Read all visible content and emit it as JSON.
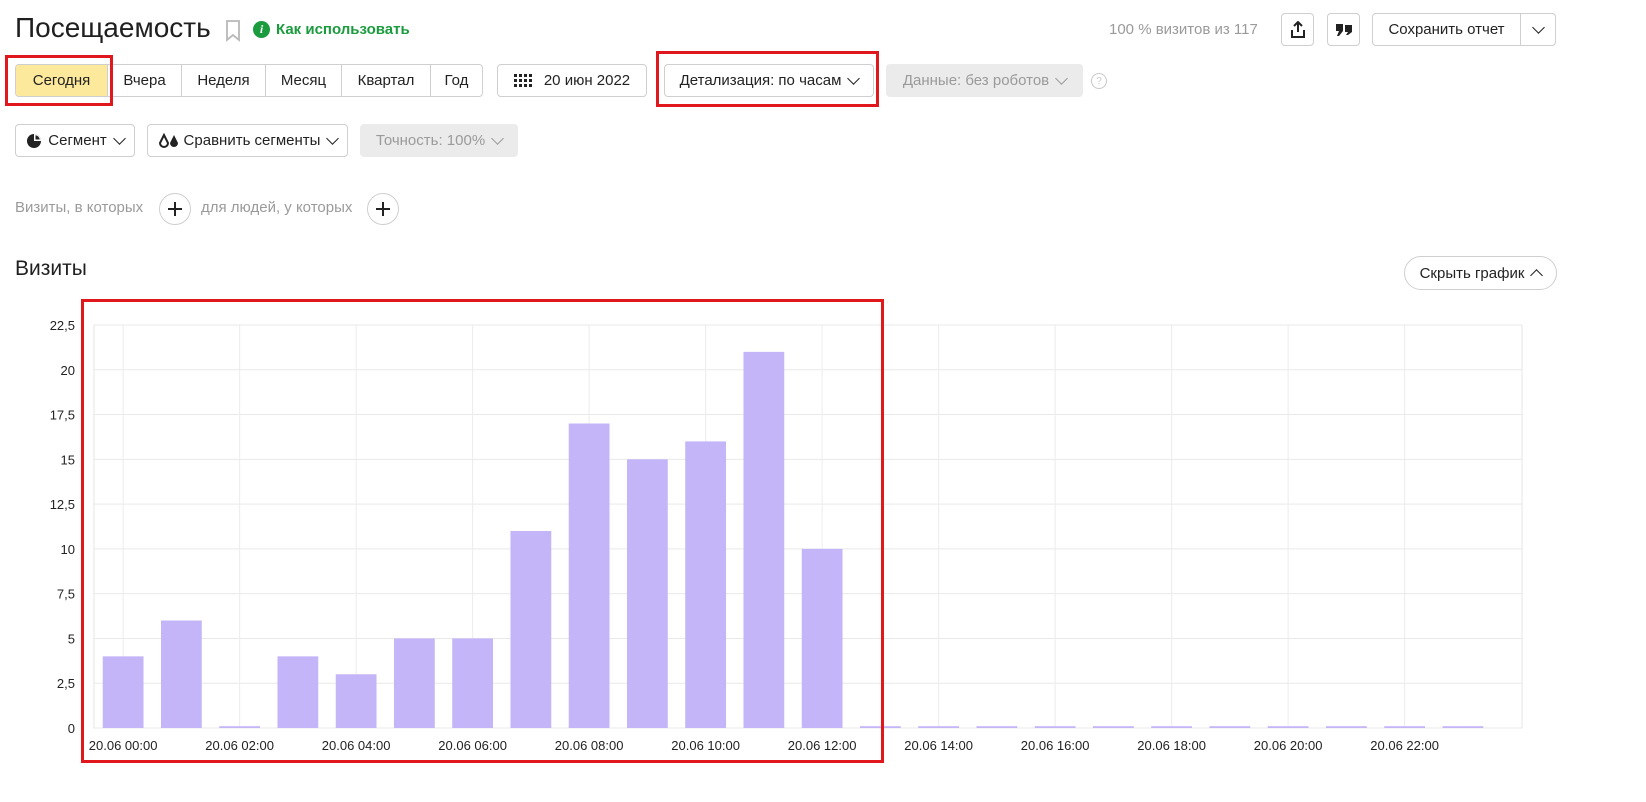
{
  "header": {
    "title": "Посещаемость",
    "how_to_use": "Как использовать",
    "visits_info": "100 % визитов из 117",
    "save_report": "Сохранить отчет"
  },
  "periods": [
    "Сегодня",
    "Вчера",
    "Неделя",
    "Месяц",
    "Квартал",
    "Год"
  ],
  "active_period": "Сегодня",
  "date_button": "20 июн 2022",
  "detail_button": "Детализация: по часам",
  "data_button": "Данные: без роботов",
  "segment_button": "Сегмент",
  "compare_button": "Сравнить сегменты",
  "accuracy_button": "Точность: 100%",
  "filters": {
    "visits_label": "Визиты, в которых",
    "people_label": "для людей, у которых"
  },
  "section": {
    "title": "Визиты",
    "hide_chart": "Скрыть график"
  },
  "colors": {
    "accent_green": "#1a9b3e",
    "active_period_bg": "#fde99b",
    "bar": "#c3b5f8",
    "highlight_box": "#e0181e"
  },
  "chart_data": {
    "type": "bar",
    "categories": [
      "20.06 00:00",
      "20.06 01:00",
      "20.06 02:00",
      "20.06 03:00",
      "20.06 04:00",
      "20.06 05:00",
      "20.06 06:00",
      "20.06 07:00",
      "20.06 08:00",
      "20.06 09:00",
      "20.06 10:00",
      "20.06 11:00",
      "20.06 12:00",
      "20.06 13:00",
      "20.06 14:00",
      "20.06 15:00",
      "20.06 16:00",
      "20.06 17:00",
      "20.06 18:00",
      "20.06 19:00",
      "20.06 20:00",
      "20.06 21:00",
      "20.06 22:00",
      "20.06 23:00"
    ],
    "values": [
      4,
      6,
      0,
      4,
      3,
      5,
      5,
      11,
      17,
      15,
      16,
      21,
      10,
      0,
      0,
      0,
      0,
      0,
      0,
      0,
      0,
      0,
      0,
      0
    ],
    "x_tick_labels": [
      "20.06 00:00",
      "20.06 02:00",
      "20.06 04:00",
      "20.06 06:00",
      "20.06 08:00",
      "20.06 10:00",
      "20.06 12:00",
      "20.06 14:00",
      "20.06 16:00",
      "20.06 18:00",
      "20.06 20:00",
      "20.06 22:00"
    ],
    "y_ticks": [
      0,
      2.5,
      5,
      7.5,
      10,
      12.5,
      15,
      17.5,
      20,
      22.5
    ],
    "y_tick_labels": [
      "0",
      "2,5",
      "5",
      "7,5",
      "10",
      "12,5",
      "15",
      "17,5",
      "20",
      "22,5"
    ],
    "ylim": [
      0,
      22.5
    ],
    "grid": true,
    "legend": "none",
    "title": "",
    "xlabel": "",
    "ylabel": ""
  }
}
